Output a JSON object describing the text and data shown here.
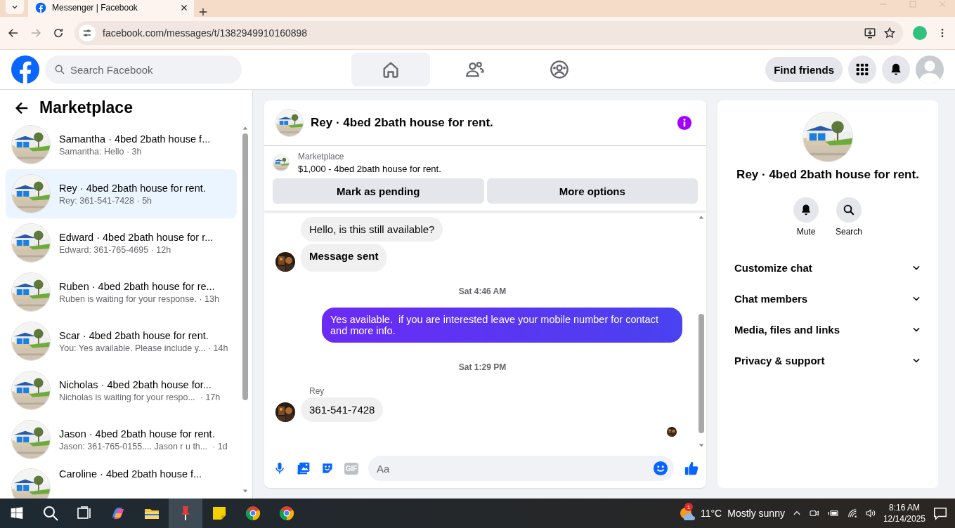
{
  "browser": {
    "tab_title": "Messenger | Facebook",
    "url": "facebook.com/messages/t/1382949910160898"
  },
  "header": {
    "search_placeholder": "Search Facebook",
    "nav": [
      {
        "kind": "home",
        "selected": true
      },
      {
        "kind": "friends",
        "selected": false
      },
      {
        "kind": "groups",
        "selected": false
      }
    ],
    "find_friends": "Find friends"
  },
  "sidebar": {
    "title": "Marketplace",
    "conversations": [
      {
        "title": "Samantha · 4bed 2bath house f...",
        "preview": "Samantha: Hello · 3h",
        "selected": false
      },
      {
        "title": "Rey · 4bed 2bath house for rent.",
        "preview": "Rey: 361-541-7428 · 5h",
        "selected": true
      },
      {
        "title": "Edward · 4bed 2bath house for r...",
        "preview": "Edward: 361-765-4695 · 12h",
        "selected": false
      },
      {
        "title": "Ruben · 4bed 2bath house for re...",
        "preview": "Ruben is waiting for your response. · 13h",
        "selected": false
      },
      {
        "title": "Scar · 4bed 2bath house for rent.",
        "preview": "You: Yes available. Please include y... · 14h",
        "selected": false
      },
      {
        "title": "Nicholas · 4bed 2bath house for...",
        "preview": "Nicholas is waiting for your respo...  · 17h",
        "selected": false
      },
      {
        "title": "Jason · 4bed 2bath house for rent.",
        "preview": "Jason: 361-765-0155.... Jason r u th...  · 1d",
        "selected": false
      },
      {
        "title": "Caroline · 4bed 2bath house f...",
        "selected": false
      }
    ]
  },
  "chat": {
    "title": "Rey · 4bed 2bath house for rent.",
    "listing": {
      "label": "Marketplace",
      "title": "$1,000 - 4bed 2bath house for rent.",
      "buttons": [
        "Mark as pending",
        "More options"
      ]
    },
    "messages": [
      {
        "kind": "incoming",
        "text": "Hello, is this still available?",
        "avatar": false,
        "bold": false
      },
      {
        "kind": "incoming",
        "text": "Message sent",
        "avatar": true,
        "bold": true
      },
      {
        "kind": "timestamp",
        "text": "Sat 4:46 AM"
      },
      {
        "kind": "outgoing",
        "text": "Yes available.  if you are interested leave your mobile number for contact and more info."
      },
      {
        "kind": "timestamp",
        "text": "Sat 1:29 PM"
      },
      {
        "kind": "sender",
        "text": "Rey"
      },
      {
        "kind": "incoming",
        "text": "361-541-7428",
        "avatar": true,
        "bold": false
      },
      {
        "kind": "seen"
      }
    ],
    "composer": {
      "gif_label": "GIF",
      "placeholder": "Aa"
    }
  },
  "info_panel": {
    "title": "Rey · 4bed 2bath house for rent.",
    "actions": [
      {
        "kind": "bell",
        "label": "Mute"
      },
      {
        "kind": "search",
        "label": "Search"
      }
    ],
    "sections": [
      "Customize chat",
      "Chat members",
      "Media, files and links",
      "Privacy & support"
    ]
  },
  "taskbar": {
    "apps": [
      {
        "kind": "search",
        "selected": false
      },
      {
        "kind": "taskview",
        "selected": false
      },
      {
        "kind": "copilot",
        "selected": false
      },
      {
        "kind": "folder",
        "selected": false
      },
      {
        "kind": "pin",
        "selected": true
      },
      {
        "kind": "notes",
        "selected": false
      },
      {
        "kind": "chrome",
        "selected": false
      },
      {
        "kind": "chrome",
        "selected": false
      }
    ],
    "weather": {
      "badge": "1",
      "temperature": "11°C",
      "condition": "Mostly sunny"
    },
    "time": "8:16 AM",
    "date": "12/14/2025"
  }
}
